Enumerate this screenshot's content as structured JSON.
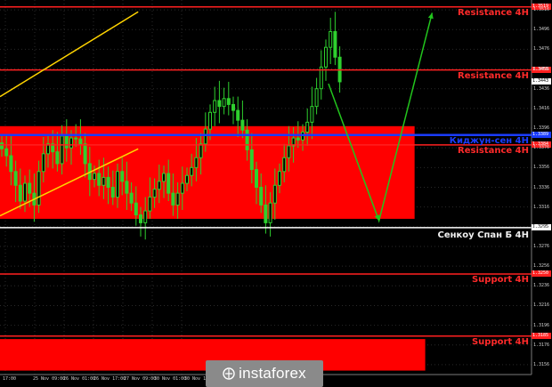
{
  "chart_data": {
    "type": "candlestick",
    "instrument_timeframe": "4H",
    "y_axis": {
      "range": [
        1.3146,
        1.3526
      ],
      "tick_labels": [
        "1.3516",
        "1.3496",
        "1.3476",
        "1.3456",
        "1.3436",
        "1.3416",
        "1.3396",
        "1.3376",
        "1.3356",
        "1.3336",
        "1.3316",
        "1.3296",
        "1.3276",
        "1.3256",
        "1.3236",
        "1.3216",
        "1.3196",
        "1.3176",
        "1.3156"
      ]
    },
    "x_axis": {
      "tick_labels": [
        "17:00",
        "25 Nov 09:00",
        "26 Nov 01:00",
        "26 Nov 17:00",
        "27 Nov 09:00",
        "30 Nov 01:00",
        "30 Nov 1"
      ]
    },
    "levels": [
      {
        "label": "Resistance 4H",
        "price": 1.3519,
        "color": "#ff2020",
        "price_tag": "1.3519"
      },
      {
        "label": "Resistance 4H",
        "price": 1.3455,
        "color": "#ff2020",
        "price_tag": "1.3455"
      },
      {
        "label": "Киджун-сен 4H",
        "price": 1.3389,
        "color": "#1a3cff",
        "price_tag": "1.3389"
      },
      {
        "label": "Resistance 4H",
        "price": 1.3379,
        "color": "#ff2020",
        "price_tag": "1.3384"
      },
      {
        "label": "Сенкоу Спан Б 4H",
        "price": 1.3295,
        "color": "#ffffff",
        "price_tag": "1.3295"
      },
      {
        "label": "Support 4H",
        "price": 1.3248,
        "color": "#ff2020",
        "price_tag": "1.3250"
      },
      {
        "label": "Support 4H",
        "price": 1.3185,
        "color": "#ff2020",
        "price_tag": "1.3185"
      }
    ],
    "current_price": "1.3443",
    "zones": [
      {
        "from": 1.3304,
        "to": 1.3398,
        "color": "#ff0000",
        "x_end_frac": 0.78
      },
      {
        "from": 1.315,
        "to": 1.3182,
        "color": "#ff0000",
        "x_end_frac": 0.8
      }
    ],
    "trend_lines": [
      {
        "color": "#ffd400",
        "from": [
          0.0,
          1.3428
        ],
        "to": [
          0.26,
          1.3514
        ]
      },
      {
        "color": "#ffd400",
        "from": [
          0.0,
          1.3307
        ],
        "to": [
          0.26,
          1.3375
        ]
      }
    ],
    "forecast_path": {
      "color": "#22c51d",
      "points": [
        [
          0.618,
          1.3441
        ],
        [
          0.713,
          1.3302
        ],
        [
          0.813,
          1.3513
        ]
      ]
    },
    "closes": [
      1.3375,
      1.3368,
      1.3352,
      1.3338,
      1.3322,
      1.334,
      1.333,
      1.3318,
      1.3352,
      1.337,
      1.338,
      1.3372,
      1.336,
      1.3388,
      1.3376,
      1.3386,
      1.3385,
      1.338,
      1.336,
      1.3344,
      1.335,
      1.3338,
      1.3346,
      1.3336,
      1.3326,
      1.3352,
      1.3342,
      1.333,
      1.332,
      1.3308,
      1.33,
      1.3312,
      1.3326,
      1.3334,
      1.3342,
      1.335,
      1.333,
      1.3318,
      1.333,
      1.334,
      1.3348,
      1.3356,
      1.3366,
      1.338,
      1.3395,
      1.3412,
      1.3424,
      1.3418,
      1.3426,
      1.342,
      1.3414,
      1.3404,
      1.3394,
      1.3374,
      1.3354,
      1.3336,
      1.3318,
      1.33,
      1.332,
      1.3338,
      1.3352,
      1.3366,
      1.3378,
      1.3386,
      1.3384,
      1.3392,
      1.3402,
      1.3418,
      1.3436,
      1.3458,
      1.3478,
      1.3494,
      1.3468,
      1.3443
    ]
  },
  "watermark": {
    "text": "instaforex"
  }
}
